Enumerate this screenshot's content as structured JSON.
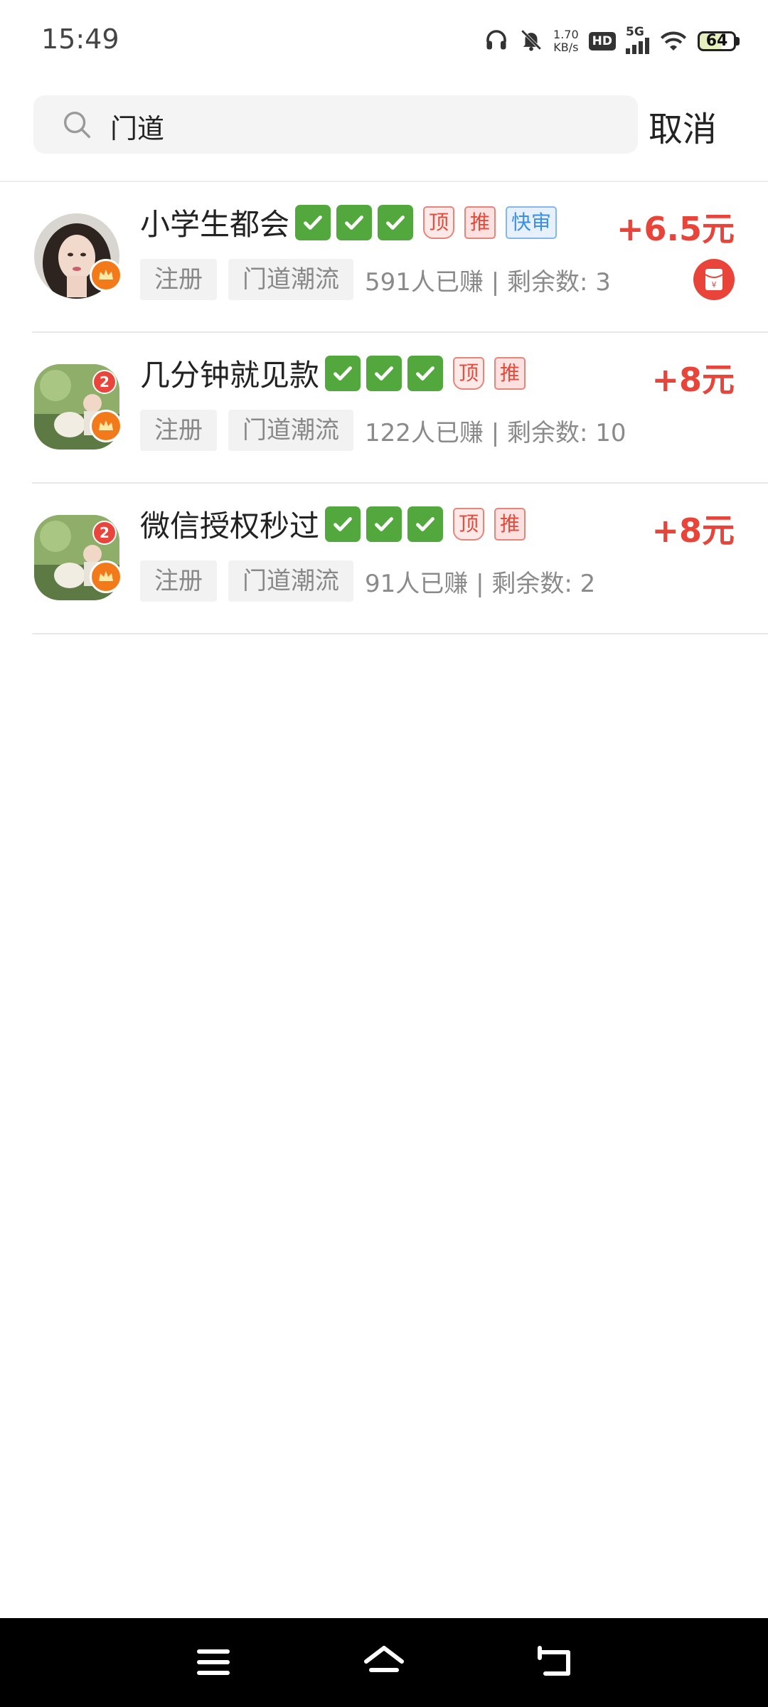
{
  "status_bar": {
    "time": "15:49",
    "net_speed_value": "1.70",
    "net_speed_unit": "KB/s",
    "hd_label": "HD",
    "network_label": "5G",
    "battery_level": "64",
    "icons": [
      "headphones-icon",
      "mute-bell-icon",
      "wifi-icon",
      "battery-icon"
    ]
  },
  "search": {
    "query": "门道",
    "cancel_label": "取消"
  },
  "tasks": [
    {
      "title": "小学生都会",
      "checks": 3,
      "tags": [
        "顶",
        "推",
        "快审"
      ],
      "chips": [
        "注册",
        "门道潮流"
      ],
      "stats": "591人已赚 | 剩余数: 3",
      "reward": "+6.5元",
      "has_red_packet": true,
      "has_notif_badge": false
    },
    {
      "title": "几分钟就见款",
      "checks": 3,
      "tags": [
        "顶",
        "推"
      ],
      "chips": [
        "注册",
        "门道潮流"
      ],
      "stats": "122人已赚 | 剩余数: 10",
      "reward": "+8元",
      "has_red_packet": false,
      "has_notif_badge": true,
      "notif_count": "2"
    },
    {
      "title": "微信授权秒过",
      "checks": 3,
      "tags": [
        "顶",
        "推"
      ],
      "chips": [
        "注册",
        "门道潮流"
      ],
      "stats": "91人已赚 | 剩余数: 2",
      "reward": "+8元",
      "has_red_packet": false,
      "has_notif_badge": true,
      "notif_count": "2"
    }
  ],
  "red_packet_symbol": "¥",
  "colors": {
    "accent_red": "#e8443a",
    "check_green": "#53a83d",
    "fast_blue": "#3a8ee6"
  },
  "nav_bar": {
    "icons": [
      "menu-icon",
      "home-icon",
      "back-icon"
    ]
  }
}
